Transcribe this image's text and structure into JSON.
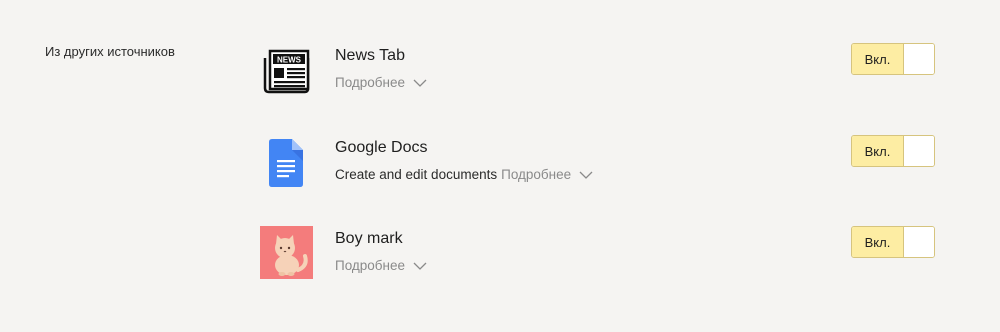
{
  "section": {
    "label": "Из других источников"
  },
  "extensions": [
    {
      "name": "News Tab",
      "description": "",
      "more_label": "Подробнее",
      "icon": "newspaper-icon",
      "toggle_label": "Вкл."
    },
    {
      "name": "Google Docs",
      "description": "Create and edit documents",
      "more_label": "Подробнее",
      "icon": "google-docs-icon",
      "toggle_label": "Вкл."
    },
    {
      "name": "Boy mark",
      "description": "",
      "more_label": "Подробнее",
      "icon": "cat-icon",
      "toggle_label": "Вкл."
    }
  ],
  "colors": {
    "background": "#f5f4f2",
    "toggle_on": "#fdeda3",
    "toggle_border": "#d6c47e",
    "docs_blue": "#4285f4",
    "cat_bg": "#f47c7c",
    "muted_text": "#8a8a8a"
  }
}
